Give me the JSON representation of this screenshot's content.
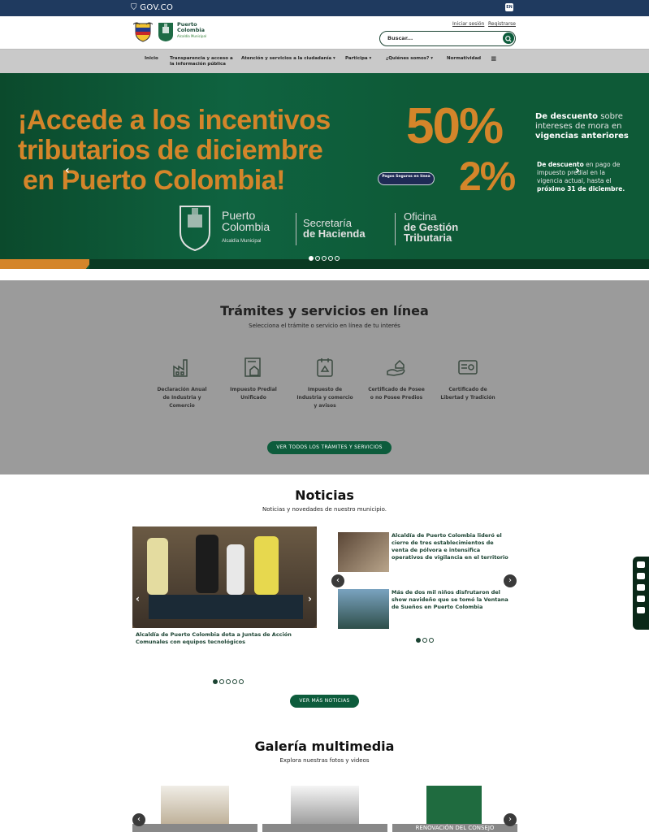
{
  "gov": {
    "logo": "GOV.CO",
    "lang": "EN"
  },
  "header": {
    "brand_line1": "Puerto",
    "brand_line2": "Colombia",
    "brand_line3": "Alcaldía Municipal",
    "login": "Iniciar sesión",
    "register": "Registrarse",
    "search_placeholder": "Buscar..."
  },
  "nav": {
    "items": [
      "Inicio",
      "Transparencia y acceso a la información pública",
      "Atención y servicios a la ciudadanía",
      "Participa",
      "¿Quiénes somos?",
      "Normatividad"
    ]
  },
  "hero": {
    "headline_1": "¡Accede a los incentivos",
    "headline_2": "tributarios de diciembre",
    "headline_3": "en Puerto Colombia!",
    "pct_1": "50%",
    "pct_1_text_bold": "De descuento",
    "pct_1_text": " sobre intereses de mora en",
    "pct_1_text_bold_2": "vigencias anteriores",
    "pct_2": "2%",
    "pct_2_text_bold": "De descuento",
    "pct_2_text": " en pago de impuesto predial en la vigencia actual, hasta el",
    "pct_2_text_bold_2": "próximo 31 de diciembre.",
    "pay_button": "Pagos Seguros en línea",
    "org_1_a": "Puerto",
    "org_1_b": "Colombia",
    "org_1_c": "Alcaldía Municipal",
    "org_2_a": "Secretaría",
    "org_2_b": "de Hacienda",
    "org_3_a": "Oficina",
    "org_3_b": "de Gestión",
    "org_3_c": "Tributaria"
  },
  "tramites": {
    "title": "Trámites y servicios en línea",
    "subtitle": "Selecciona el trámite o servicio en línea de tu interés",
    "items": [
      {
        "label": "Declaración Anual de Industria y Comercio",
        "icon": "factory-icon"
      },
      {
        "label": "Impuesto Predial Unificado",
        "icon": "property-document-icon"
      },
      {
        "label": "Impuesto de Industria y comercio y avisos",
        "icon": "calendar-tax-icon"
      },
      {
        "label": "Certificado de Posee o no Posee Predios",
        "icon": "hand-house-icon"
      },
      {
        "label": "Certificado de Libertad y Tradición",
        "icon": "certificate-icon"
      }
    ],
    "button": "VER TODOS LOS TRÁMITES Y SERVICIOS"
  },
  "noticias": {
    "title": "Noticias",
    "subtitle": "Noticias y novedades de nuestro municipio.",
    "main_caption": "Alcaldía de Puerto Colombia dota a Juntas de Acción Comunales con equipos tecnológicos",
    "side": [
      "Alcaldía de Puerto Colombia lideró el cierre de tres establecimientos de venta de pólvora e intensifica operativos de vigilancia en el territorio",
      "Más de dos mil niños disfrutaron del show navideño que se tomó la Ventana de Sueños en Puerto Colombia"
    ],
    "button": "VER MÁS NOTICIAS"
  },
  "galeria": {
    "title": "Galería multimedia",
    "subtitle": "Explora nuestras fotos y videos",
    "item_3_caption": "RENOVACIÓN DEL CONSEJO"
  },
  "colors": {
    "gov_blue": "#1f3a5f",
    "brand_green": "#0d5c3c",
    "accent_orange": "#d4852a",
    "hero_green": "#0e5a37"
  }
}
